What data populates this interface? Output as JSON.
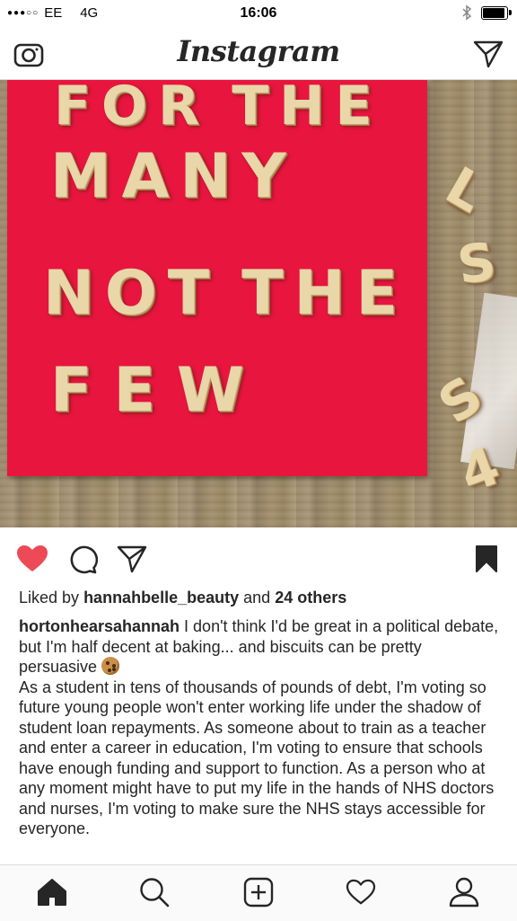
{
  "status_bar": {
    "signal_dots": "●●●○○",
    "carrier": "EE",
    "network": "4G",
    "time": "16:06",
    "battery_level": 0.85
  },
  "header": {
    "title": "Instagram",
    "camera_icon": "camera-icon",
    "direct_icon": "paper-plane-icon"
  },
  "post": {
    "image": {
      "board_color": "#e8163f",
      "biscuit_rows": [
        [
          "F",
          "O",
          "R",
          " ",
          "T",
          "H",
          "E"
        ],
        [
          "M",
          "A",
          "N",
          "Y"
        ],
        [
          "N",
          "O",
          "T",
          " ",
          "T",
          "H",
          "E"
        ],
        [
          "F",
          "E",
          "W"
        ]
      ],
      "side_letters": [
        "L",
        "S",
        "S",
        "4"
      ]
    },
    "actions": {
      "like_icon": "heart-filled-icon",
      "comment_icon": "comment-bubble-icon",
      "share_icon": "paper-plane-icon",
      "save_icon": "bookmark-filled-icon",
      "like_color": "#ed4956"
    },
    "likes": {
      "prefix": "Liked by",
      "user": "hannahbelle_beauty",
      "conjunction": "and",
      "others": "24 others"
    },
    "caption": {
      "username": "hortonhearsahannah",
      "text_1": "I don't think I'd be great in a political debate, but I'm half decent at baking... and biscuits can be pretty persuasive",
      "emoji": "cookie-emoji",
      "text_2": "As a student in tens of thousands of pounds of debt, I'm voting so future young people won't enter working life under the shadow of student loan repayments. As someone about to train as a teacher and enter a career in education, I'm voting to ensure that schools have enough funding and support to function. As a person who at any moment might have to put my life in the hands of NHS doctors and nurses, I'm voting to make sure the NHS stays accessible for everyone."
    }
  },
  "tab_bar": {
    "items": [
      {
        "name": "home",
        "icon": "home-filled-icon",
        "active": true
      },
      {
        "name": "search",
        "icon": "search-icon",
        "active": false
      },
      {
        "name": "add",
        "icon": "plus-square-icon",
        "active": false
      },
      {
        "name": "activity",
        "icon": "heart-outline-icon",
        "active": false
      },
      {
        "name": "profile",
        "icon": "person-icon",
        "active": false
      }
    ]
  }
}
